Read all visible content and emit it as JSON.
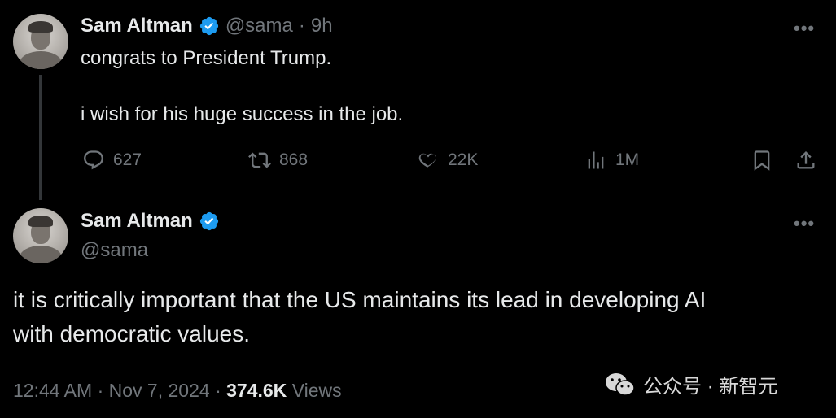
{
  "tweet1": {
    "name": "Sam Altman",
    "handle": "@sama",
    "separator": "·",
    "time": "9h",
    "line1": "congrats to President Trump.",
    "line2": "i wish for his huge success in the job.",
    "replies": "627",
    "retweets": "868",
    "likes": "22K",
    "views": "1M",
    "more_icon": "more-horizontal-icon"
  },
  "tweet2": {
    "name": "Sam Altman",
    "handle": "@sama",
    "text_line1": "it is critically important that the US maintains its lead in developing AI",
    "text_line2": "with democratic values.",
    "time": "12:44 AM",
    "date": "Nov 7, 2024",
    "view_count": "374.6K",
    "views_label": "Views"
  },
  "watermark": {
    "text": "公众号 · 新智元"
  },
  "colors": {
    "background": "#000000",
    "text": "#e7e9ea",
    "muted": "#71767b",
    "verified": "#1d9bf0",
    "thread_line": "#333639"
  }
}
